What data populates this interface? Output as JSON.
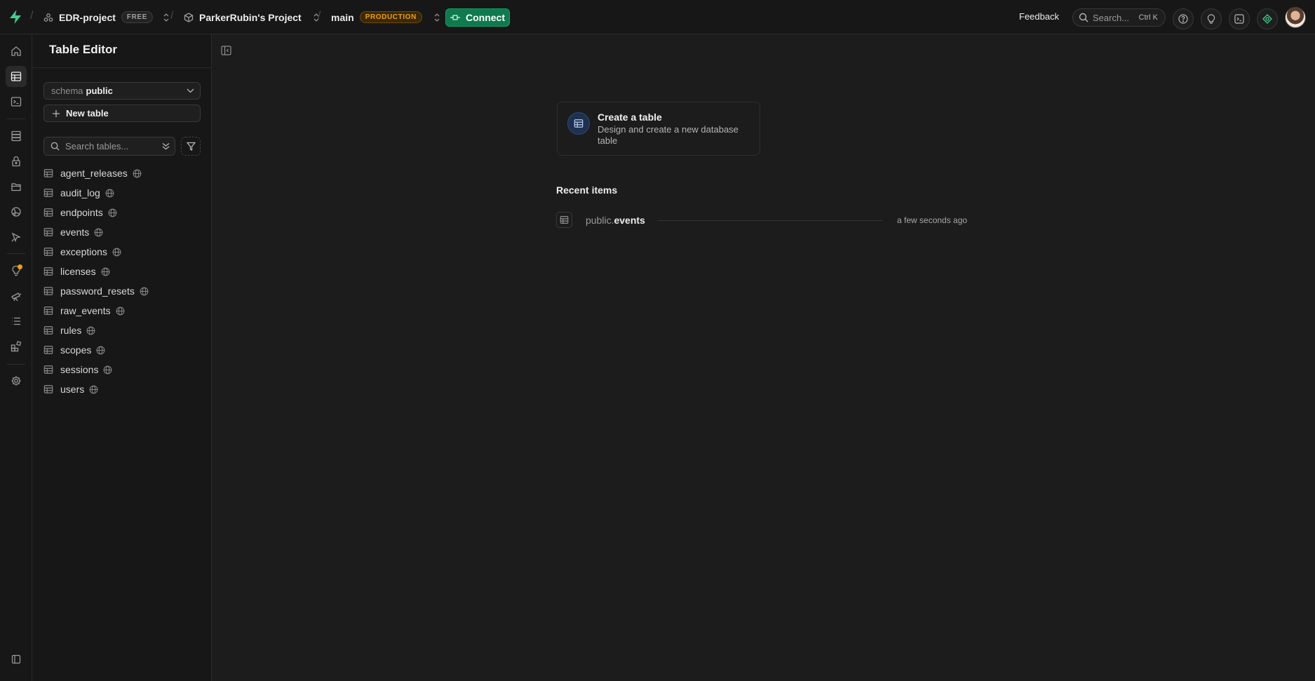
{
  "topbar": {
    "org_name": "EDR-project",
    "org_plan": "FREE",
    "project_name": "ParkerRubin's Project",
    "branch_name": "main",
    "branch_env": "PRODUCTION",
    "connect_label": "Connect",
    "feedback_label": "Feedback",
    "search_placeholder": "Search...",
    "search_shortcut": "Ctrl K",
    "icons": [
      "help-icon",
      "lightbulb-icon",
      "terminal-icon",
      "advisor-icon"
    ],
    "brand_color": "#3ecf8e",
    "production_color": "#f1a10d"
  },
  "rail": {
    "items": [
      "home-icon",
      "table-editor-icon",
      "sql-editor-icon",
      "database-icon",
      "auth-icon",
      "storage-icon",
      "realtime-icon",
      "edge-functions-icon",
      "advisors-icon",
      "reports-icon",
      "logs-icon",
      "integrations-icon",
      "settings-icon",
      "collapse-icon"
    ],
    "active": "table-editor-icon"
  },
  "sidebar": {
    "title": "Table Editor",
    "schema_label": "schema",
    "schema_value": "public",
    "new_table_label": "New table",
    "search_placeholder": "Search tables...",
    "tables": [
      {
        "name": "agent_releases"
      },
      {
        "name": "audit_log"
      },
      {
        "name": "endpoints"
      },
      {
        "name": "events"
      },
      {
        "name": "exceptions"
      },
      {
        "name": "licenses"
      },
      {
        "name": "password_resets"
      },
      {
        "name": "raw_events"
      },
      {
        "name": "rules"
      },
      {
        "name": "scopes"
      },
      {
        "name": "sessions"
      },
      {
        "name": "users"
      }
    ]
  },
  "main": {
    "create_card": {
      "title": "Create a table",
      "description": "Design and create a new database table"
    },
    "recent_title": "Recent items",
    "recent_items": [
      {
        "schema": "public.",
        "table": "events",
        "time": "a few seconds ago"
      }
    ]
  }
}
